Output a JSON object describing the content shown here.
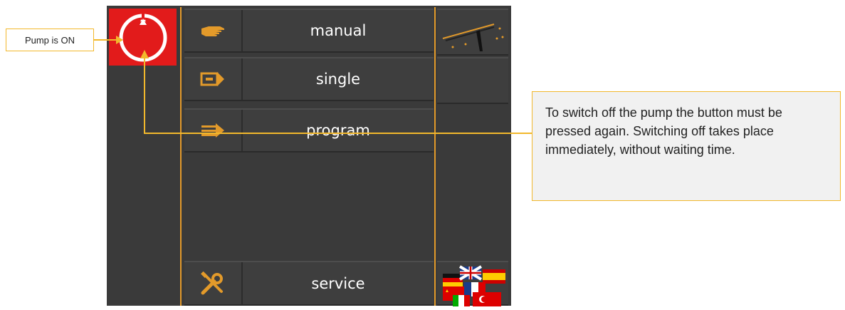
{
  "annotations": {
    "pump_status": "Pump is ON",
    "switch_off_info": "To switch off the pump the button must be pressed again. Switching off takes place immediately, without waiting time."
  },
  "menu": {
    "manual": "manual",
    "single": "single",
    "program": "program",
    "service": "service"
  },
  "colors": {
    "accent": "#e39a2a",
    "pump_on": "#e21b1b",
    "panel": "#3a3a3a",
    "callout_border": "#f2b82c"
  },
  "icons": {
    "pump": "pump-power-icon",
    "manual": "hand-icon",
    "single": "single-arrow-icon",
    "program": "program-arrow-icon",
    "service": "tools-icon",
    "wiper": "wiper-icon",
    "language": "flags-icon"
  }
}
